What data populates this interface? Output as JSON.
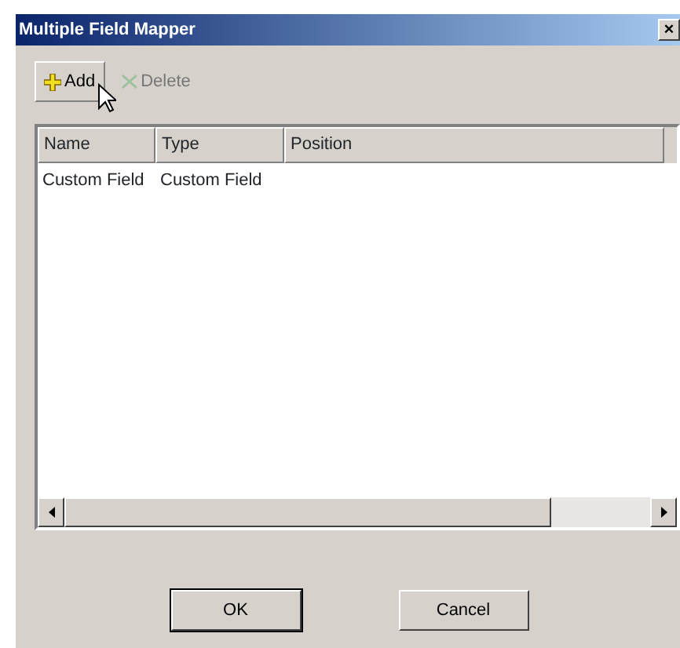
{
  "window": {
    "title": "Multiple Field Mapper",
    "close": "×"
  },
  "toolbar": [
    {
      "label": "Add",
      "kind": "add",
      "disabled": false
    },
    {
      "label": "Delete",
      "kind": "delete",
      "disabled": true
    }
  ],
  "table": {
    "columns": [
      "Name",
      "Type",
      "Position"
    ],
    "rows": [
      [
        "Custom Field",
        "Custom Field",
        ""
      ]
    ]
  },
  "buttons": [
    {
      "label": "OK",
      "default": true
    },
    {
      "label": "Cancel",
      "default": false
    }
  ]
}
